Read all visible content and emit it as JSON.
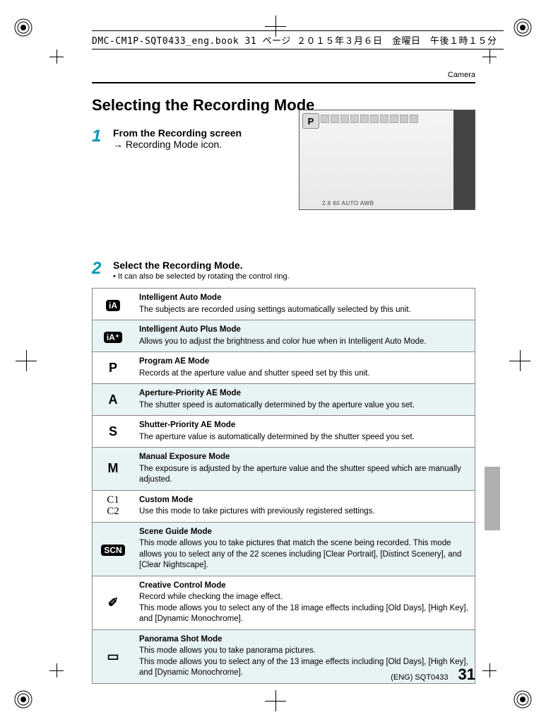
{
  "header_strip": "DMC-CM1P-SQT0433_eng.book  31 ページ  ２０１５年３月６日　金曜日　午後１時１５分",
  "section_label": "Camera",
  "title": "Selecting the Recording Mode",
  "step1_num": "1",
  "step1_line1": "From the Recording screen",
  "step1_line2": "→ Recording Mode icon.",
  "step2_num": "2",
  "step2_text": "Select the Recording Mode.",
  "step2_note": "It can also be selected by rotating the control ring.",
  "screenshot_p": "P",
  "screenshot_bottom": "2.8  60           AUTO  AWB",
  "modes": [
    {
      "icon_type": "badge",
      "icon": "iA",
      "title": "Intelligent Auto Mode",
      "desc": "The subjects are recorded using settings automatically selected by this unit."
    },
    {
      "icon_type": "badge",
      "icon": "iA⁺",
      "title": "Intelligent Auto Plus Mode",
      "desc": "Allows you to adjust the brightness and color hue when in Intelligent Auto Mode."
    },
    {
      "icon_type": "letter",
      "icon": "P",
      "title": "Program AE Mode",
      "desc": "Records at the aperture value and shutter speed set by this unit."
    },
    {
      "icon_type": "letter",
      "icon": "A",
      "title": "Aperture-Priority AE Mode",
      "desc": "The shutter speed is automatically determined by the aperture value you set."
    },
    {
      "icon_type": "letter",
      "icon": "S",
      "title": "Shutter-Priority AE Mode",
      "desc": "The aperture value is automatically determined by the shutter speed you set."
    },
    {
      "icon_type": "letter",
      "icon": "M",
      "title": "Manual Exposure Mode",
      "desc": "The exposure is adjusted by the aperture value and the shutter speed which are manually adjusted."
    },
    {
      "icon_type": "c1c2",
      "icon": "C1\nC2",
      "title": "Custom Mode",
      "desc": "Use this mode to take pictures with previously registered settings."
    },
    {
      "icon_type": "badge",
      "icon": "SCN",
      "title": "Scene Guide Mode",
      "desc": "This mode allows you to take pictures that match the scene being recorded. This mode allows you to select any of the 22 scenes including [Clear Portrait], [Distinct Scenery], and [Clear Nightscape]."
    },
    {
      "icon_type": "glyph",
      "icon": "✐",
      "title": "Creative Control Mode",
      "desc": "Record while checking the image effect.\nThis mode allows you to select any of the 18 image effects including [Old Days], [High Key], and [Dynamic Monochrome]."
    },
    {
      "icon_type": "glyph",
      "icon": "▭",
      "title": "Panorama Shot Mode",
      "desc": "This mode allows you to take panorama pictures.\nThis mode allows you to select any of the 13 image effects including [Old Days], [High Key], and [Dynamic Monochrome]."
    }
  ],
  "footer_docid": "(ENG) SQT0433",
  "footer_page": "31"
}
